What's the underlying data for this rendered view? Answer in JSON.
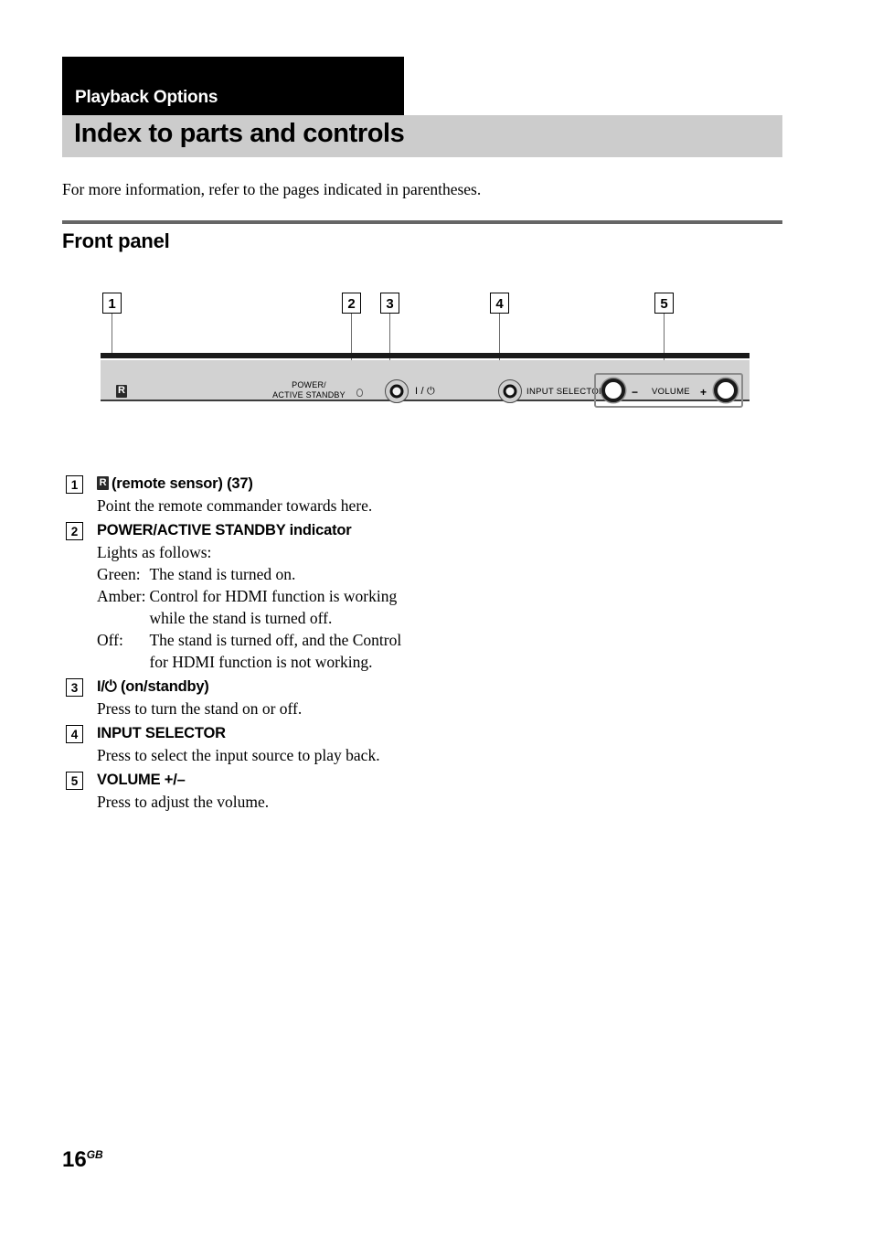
{
  "header": {
    "chapter_label": "Playback Options",
    "title": "Index to parts and controls",
    "intro": "For more information, refer to the pages indicated in parentheses.",
    "section_heading": "Front panel"
  },
  "diagram": {
    "callouts": [
      {
        "number": "1"
      },
      {
        "number": "2"
      },
      {
        "number": "3"
      },
      {
        "number": "4"
      },
      {
        "number": "5"
      }
    ],
    "panel_labels": {
      "remote_sensor_icon": "remote-sensor-icon",
      "power_line1": "POWER/",
      "power_line2": "ACTIVE STANDBY",
      "on_standby": "I / ⏻",
      "input_selector": "INPUT SELECTOR",
      "volume_minus": "−",
      "volume": "VOLUME",
      "volume_plus": "+"
    }
  },
  "legend": {
    "items": [
      {
        "number": "1",
        "title_suffix": "(remote sensor) (37)",
        "has_sensor_icon": true,
        "desc": "Point the remote commander towards here."
      },
      {
        "number": "2",
        "title": "POWER/ACTIVE STANDBY indicator",
        "desc": "Lights as follows:",
        "states": [
          {
            "label": "Green:",
            "text": "The stand is turned on."
          },
          {
            "label": "Amber:",
            "text": "Control for HDMI function is working while the stand is turned off."
          },
          {
            "label": "Off:",
            "text": "The stand is turned off, and the Control for HDMI function is not working."
          }
        ]
      },
      {
        "number": "3",
        "title": "I/⏻ (on/standby)",
        "desc": "Press to turn the stand on or off."
      },
      {
        "number": "4",
        "title": "INPUT SELECTOR",
        "desc": "Press to select the input source to play back."
      },
      {
        "number": "5",
        "title": "VOLUME +/–",
        "desc": "Press to adjust the volume."
      }
    ]
  },
  "footer": {
    "page_number": "16",
    "page_suffix": "GB"
  },
  "colors": {
    "chapter_bar": "#000000",
    "title_bar": "#cccccc",
    "rule": "#666666",
    "panel_body": "#d2d2d2",
    "panel_strip": "#1a1a1a"
  }
}
